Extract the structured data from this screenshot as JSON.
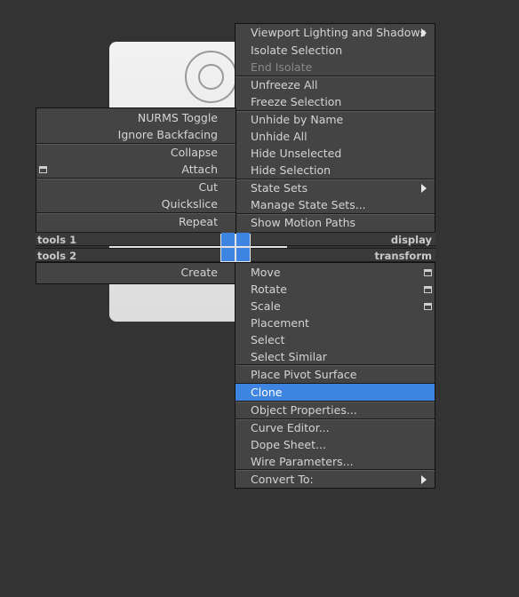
{
  "right_quad": {
    "items": [
      {
        "label": "Viewport Lighting and Shadows",
        "submenu": true
      },
      {
        "label": "Isolate Selection"
      },
      {
        "label": "End Isolate",
        "disabled": true
      },
      {
        "label": "Unfreeze All"
      },
      {
        "label": "Freeze Selection"
      },
      {
        "label": "Unhide by Name"
      },
      {
        "label": "Unhide All"
      },
      {
        "label": "Hide Unselected"
      },
      {
        "label": "Hide Selection"
      },
      {
        "label": "State Sets",
        "submenu": true
      },
      {
        "label": "Manage State Sets..."
      },
      {
        "label": "Show Motion Paths"
      }
    ],
    "title": "display"
  },
  "left_quad": {
    "items": [
      {
        "label": "NURMS Toggle"
      },
      {
        "label": "Ignore Backfacing"
      },
      {
        "label": "Collapse"
      },
      {
        "label": "Attach",
        "option": true
      },
      {
        "label": "Cut"
      },
      {
        "label": "Quickslice"
      },
      {
        "label": "Repeat"
      }
    ],
    "title": "tools 1"
  },
  "left_bottom_quad": {
    "title": "tools 2",
    "items": [
      {
        "label": "Create"
      }
    ]
  },
  "right_bottom_quad": {
    "title": "transform",
    "items": [
      {
        "label": "Move",
        "option": true
      },
      {
        "label": "Rotate",
        "option": true
      },
      {
        "label": "Scale",
        "option": true
      },
      {
        "label": "Placement"
      },
      {
        "label": "Select"
      },
      {
        "label": "Select Similar"
      },
      {
        "label": "Place Pivot Surface"
      },
      {
        "label": "Clone",
        "highlight": true
      },
      {
        "label": "Object Properties..."
      },
      {
        "label": "Curve Editor..."
      },
      {
        "label": "Dope Sheet..."
      },
      {
        "label": "Wire Parameters..."
      },
      {
        "label": "Convert To:",
        "submenu": true
      }
    ]
  },
  "colors": {
    "highlight": "#3d85e0",
    "menu_bg": "#444444",
    "background": "#333333"
  }
}
